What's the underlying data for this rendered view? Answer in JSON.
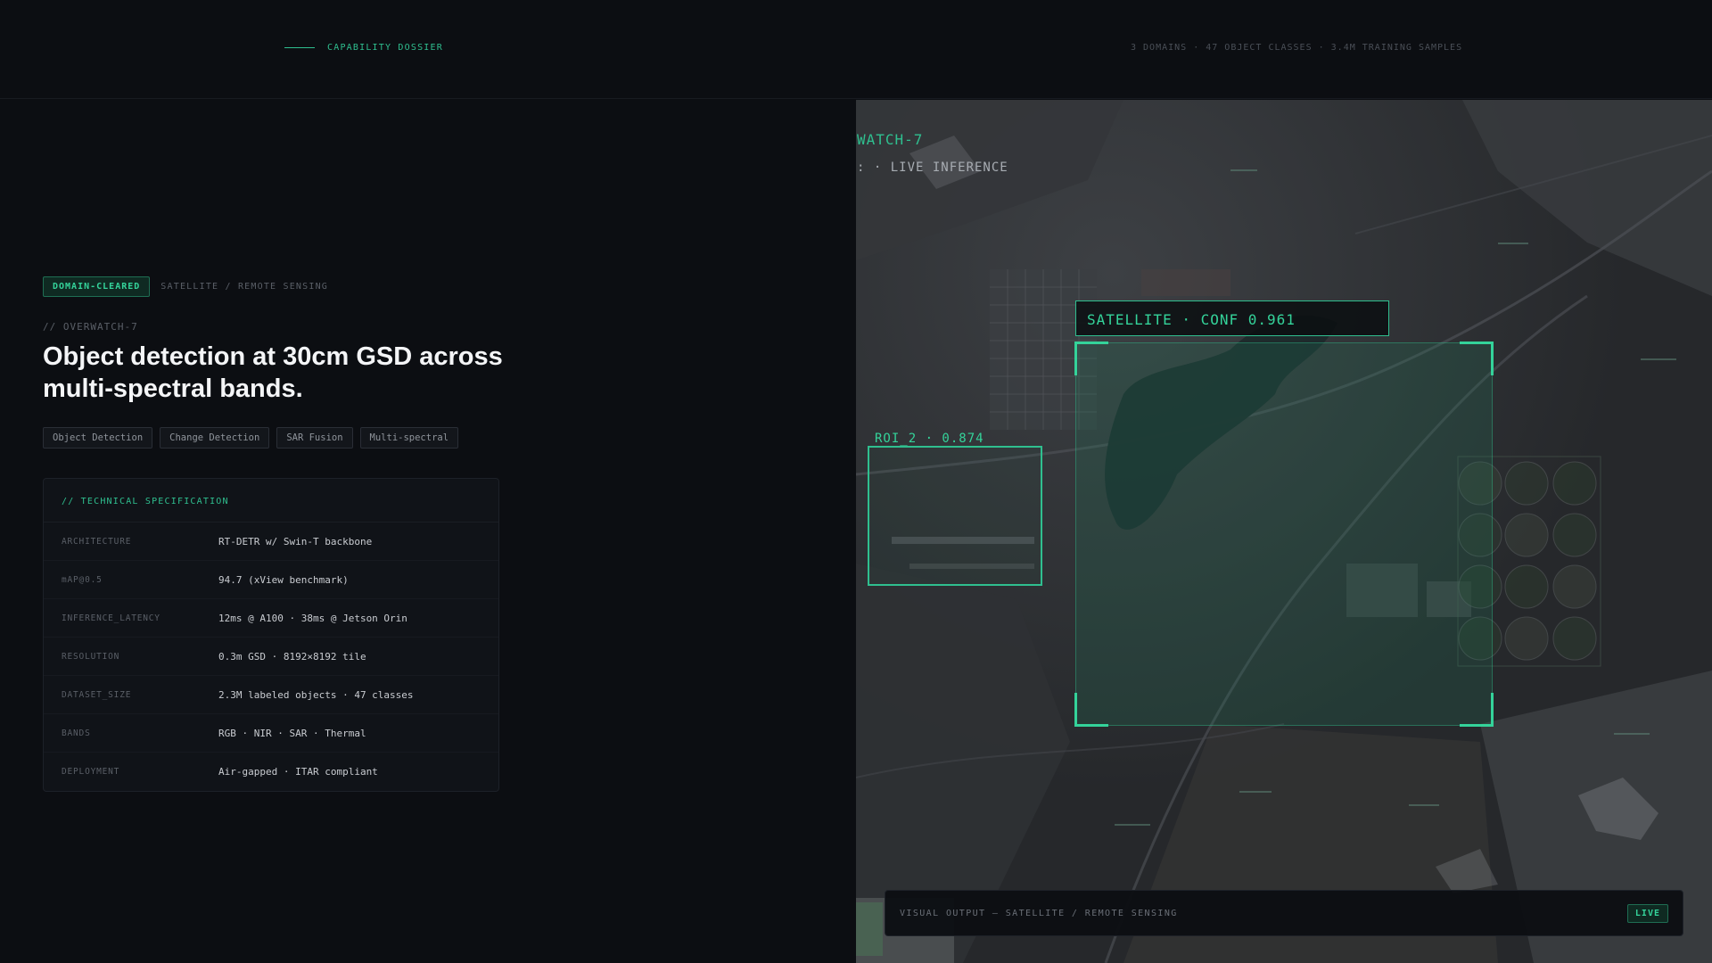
{
  "header": {
    "section_label": "CAPABILITY DOSSIER",
    "stats": "3 DOMAINS · 47 OBJECT CLASSES · 3.4M TRAINING SAMPLES"
  },
  "hero": {
    "status_badge": "DOMAIN-CLEARED",
    "domain": "SATELLITE / REMOTE SENSING",
    "system_id": "// OVERWATCH-7",
    "headline": "Object detection at 30cm GSD across multi-spectral bands.",
    "capabilities": [
      "Object Detection",
      "Change Detection",
      "SAR Fusion",
      "Multi-spectral"
    ]
  },
  "spec": {
    "title": "// TECHNICAL SPECIFICATION",
    "rows": [
      {
        "key": "ARCHITECTURE",
        "value": "RT-DETR w/ Swin-T backbone"
      },
      {
        "key": "mAP@0.5",
        "value": "94.7 (xView benchmark)"
      },
      {
        "key": "INFERENCE_LATENCY",
        "value": "12ms @ A100 · 38ms @ Jetson Orin"
      },
      {
        "key": "RESOLUTION",
        "value": "0.3m GSD · 8192×8192 tile"
      },
      {
        "key": "DATASET_SIZE",
        "value": "2.3M labeled objects · 47 classes"
      },
      {
        "key": "BANDS",
        "value": "RGB · NIR · SAR · Thermal"
      },
      {
        "key": "DEPLOYMENT",
        "value": "Air-gapped · ITAR compliant"
      }
    ]
  },
  "visual": {
    "hud_name": "WATCH-7",
    "hud_mode": ": · LIVE INFERENCE",
    "detection_main": "SATELLITE · CONF 0.961",
    "detection_roi": "ROI_2 · 0.874",
    "caption": "VISUAL OUTPUT — SATELLITE / REMOTE SENSING",
    "live_badge": "LIVE",
    "accent_color": "#34d39a"
  }
}
